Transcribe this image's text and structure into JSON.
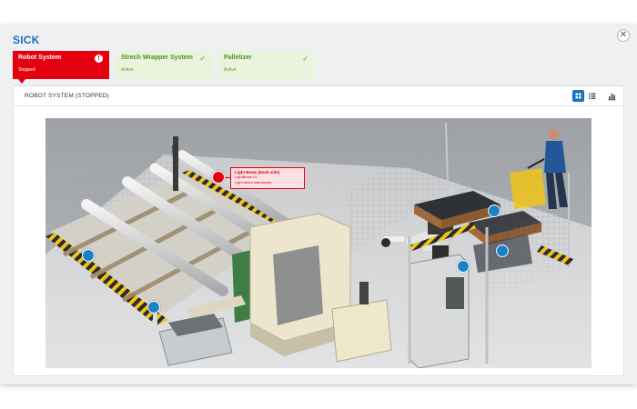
{
  "brand": {
    "logo_text": "SICK",
    "accent": "#1a6fc2",
    "alert": "#e4000f",
    "ok": "#5d9b26"
  },
  "window": {
    "close_label": "✕"
  },
  "tabs": [
    {
      "title": "Robot System",
      "status": "Stopped",
      "state": "alert",
      "icon": "alert-icon",
      "icon_glyph": "!"
    },
    {
      "title": "Strech Wrapper System",
      "status": "Active",
      "state": "ok",
      "icon": "check-icon",
      "icon_glyph": "✓"
    },
    {
      "title": "Palletizer",
      "status": "Active",
      "state": "ok",
      "icon": "check-icon",
      "icon_glyph": "✓"
    }
  ],
  "panel": {
    "title": "ROBOT SYSTEM (STOPPED)",
    "views": [
      {
        "name": "grid-view-icon",
        "active": true
      },
      {
        "name": "list-view-icon",
        "active": false
      },
      {
        "name": "chart-view-icon",
        "active": false
      }
    ]
  },
  "callout": {
    "title": "Light Beam (back side)",
    "line1": "LightBeam-01",
    "line2": "Light beam interrupted"
  }
}
